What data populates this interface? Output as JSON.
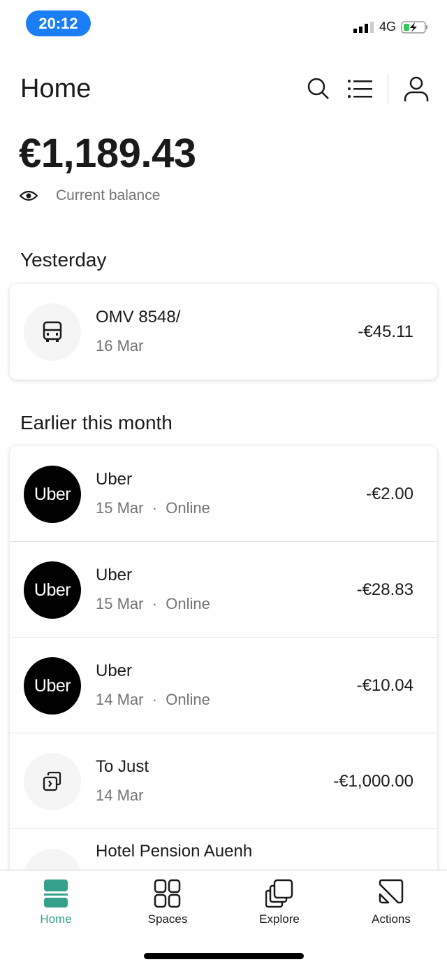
{
  "status_bar": {
    "time": "20:12",
    "network": "4G",
    "battery_color": "#34c759"
  },
  "header": {
    "title": "Home",
    "icons": [
      "search-icon",
      "list-icon",
      "profile-icon"
    ]
  },
  "balance": {
    "amount": "€1,189.43",
    "label": "Current balance"
  },
  "sections": [
    {
      "title": "Yesterday",
      "items": [
        {
          "name": "OMV 8548/",
          "date": "16 Mar",
          "amount": "-€45.11",
          "icon": "bus-icon"
        }
      ]
    },
    {
      "title": "Earlier this month",
      "items": [
        {
          "name": "Uber",
          "date": "15 Mar",
          "channel": "Online",
          "amount": "-€2.00",
          "logo": "Uber"
        },
        {
          "name": "Uber",
          "date": "15 Mar",
          "channel": "Online",
          "amount": "-€28.83",
          "logo": "Uber"
        },
        {
          "name": "Uber",
          "date": "14 Mar",
          "channel": "Online",
          "amount": "-€10.04",
          "logo": "Uber"
        },
        {
          "name": "To Just",
          "date": "14 Mar",
          "amount": "-€1,000.00",
          "icon": "transfer-icon"
        },
        {
          "name": "Hotel Pension Auenh",
          "icon": "bed-icon"
        }
      ]
    }
  ],
  "separator": "·",
  "nav": {
    "items": [
      {
        "label": "Home",
        "active": true
      },
      {
        "label": "Spaces"
      },
      {
        "label": "Explore"
      },
      {
        "label": "Actions"
      }
    ],
    "accent": "#36a18a"
  }
}
